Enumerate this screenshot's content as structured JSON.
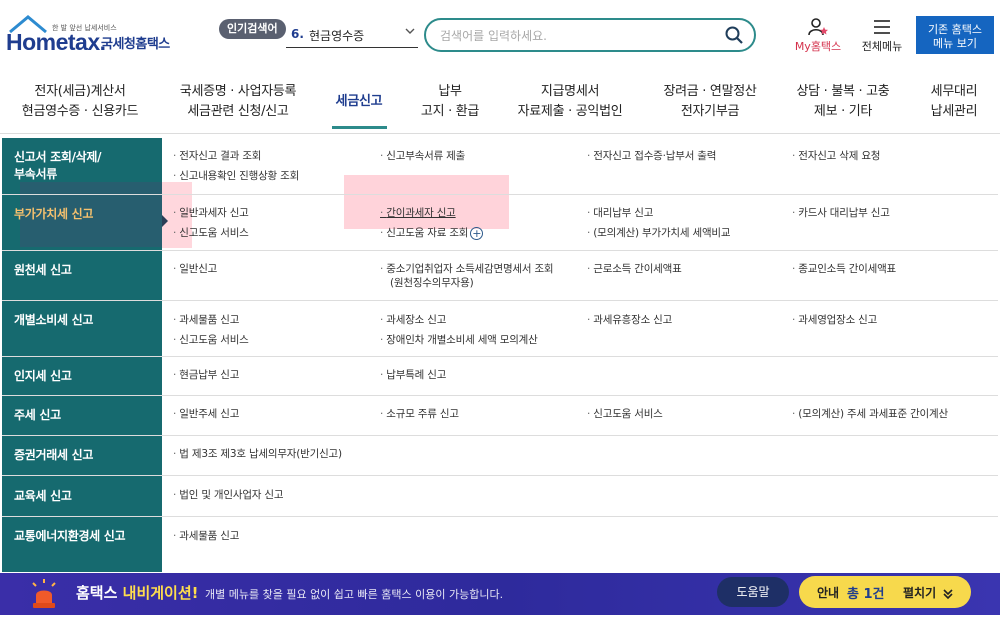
{
  "header": {
    "logo_small": "한 발 앞선 납세서비스",
    "logo_main": "Hometax.",
    "logo_kr": "국세청홈택스",
    "popular_tag": "인기검색어",
    "popular_num": "6.",
    "popular_text": "현금영수증",
    "search_placeholder": "검색어를 입력하세요.",
    "my_hometax": "My홈택스",
    "all_menu": "전체메뉴",
    "old_menu": "기존 홈택스\n메뉴 보기"
  },
  "nav": [
    {
      "label": "전자(세금)계산서\n현금영수증 · 신용카드"
    },
    {
      "label": "국세증명 · 사업자등록\n세금관련 신청/신고"
    },
    {
      "label": "세금신고"
    },
    {
      "label": "납부\n고지 · 환급"
    },
    {
      "label": "지급명세서\n자료제출 · 공익법인"
    },
    {
      "label": "장려금 · 연말정산\n전자기부금"
    },
    {
      "label": "상담 · 불복 · 고충\n제보 · 기타"
    },
    {
      "label": "세무대리\n납세관리"
    }
  ],
  "categories": [
    {
      "label": "신고서 조회/삭제/\n부속서류",
      "items": [
        "전자신고 결과 조회",
        "신고부속서류 제출",
        "전자신고 접수증·납부서 출력",
        "전자신고 삭제 요청",
        "신고내용확인 진행상황 조회"
      ]
    },
    {
      "label": "부가가치세 신고",
      "items": [
        "일반과세자 신고",
        "간이과세자 신고",
        "대리납부 신고",
        "카드사 대리납부 신고",
        "신고도움 서비스",
        "신고도움 자료 조회",
        "(모의계산) 부가가치세 세액비교"
      ]
    },
    {
      "label": "원천세 신고",
      "items": [
        "일반신고",
        "중소기업취업자 소득세감면명세서 조회",
        "(원천징수의무자용)",
        "근로소득 간이세액표",
        "종교인소득 간이세액표"
      ]
    },
    {
      "label": "개별소비세 신고",
      "items": [
        "과세물품 신고",
        "과세장소 신고",
        "과세유흥장소 신고",
        "과세영업장소 신고",
        "신고도움 서비스",
        "장애인차 개별소비세 세액 모의계산"
      ]
    },
    {
      "label": "인지세 신고",
      "items": [
        "현금납부 신고",
        "납부특례 신고"
      ]
    },
    {
      "label": "주세 신고",
      "items": [
        "일반주세 신고",
        "소규모 주류 신고",
        "신고도움 서비스",
        "(모의계산) 주세 과세표준 간이계산"
      ]
    },
    {
      "label": "증권거래세 신고",
      "items": [
        "법 제3조 제3호 납세의무자(반기신고)"
      ]
    },
    {
      "label": "교육세 신고",
      "items": [
        "법인 및 개인사업자 신고"
      ]
    },
    {
      "label": "교통에너지환경세 신고",
      "items": [
        "과세물품 신고"
      ]
    }
  ],
  "banner": {
    "title_prefix": "홈택스",
    "title_highlight": "내비게이션!",
    "desc": "개별 메뉴를 찾을 필요 없이 쉽고 빠른 홈택스 이용이 가능합니다.",
    "help": "도움말",
    "guide_label": "안내",
    "guide_count": "총 1건",
    "expand": "펼치기"
  },
  "colors": {
    "sidebar": "#166a6f",
    "brand": "#1f3d8f",
    "accent": "#2d8b8b",
    "banner": "#3a35a8",
    "guide": "#f7d94c"
  }
}
